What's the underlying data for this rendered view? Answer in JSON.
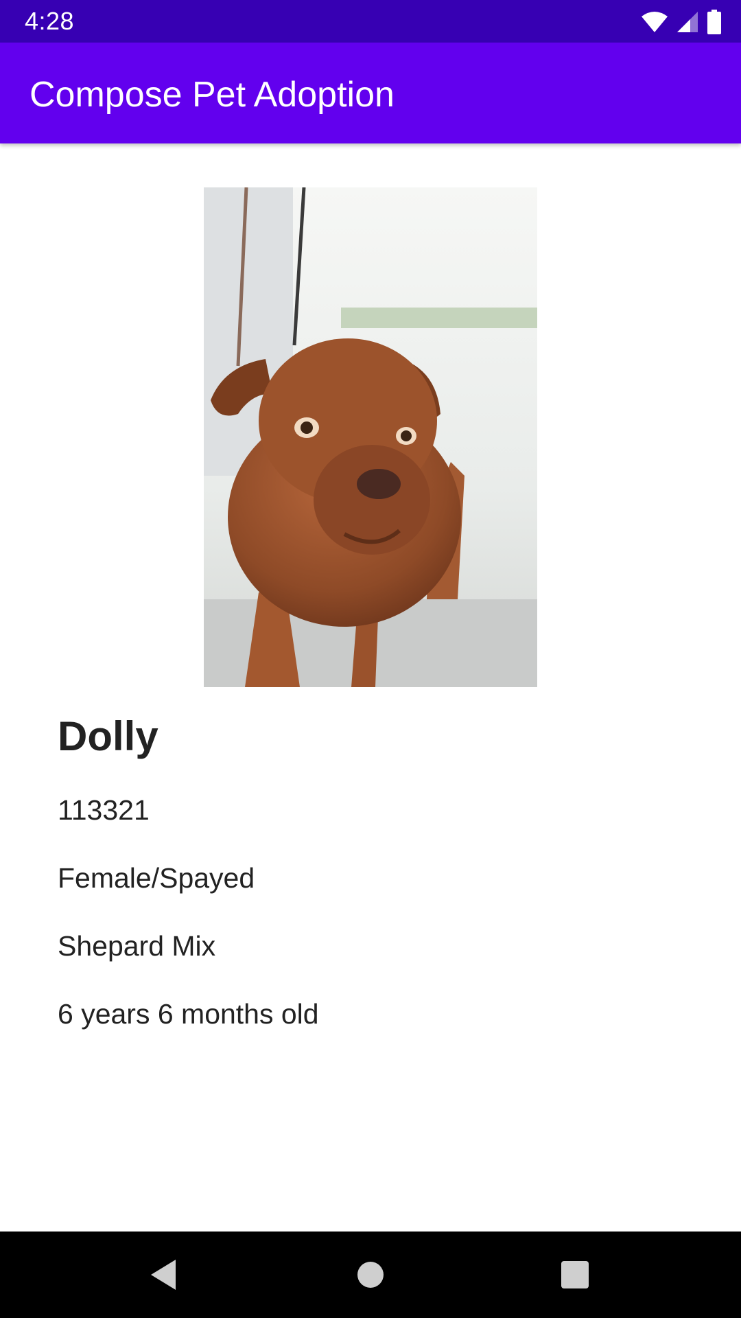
{
  "status_bar": {
    "time": "4:28",
    "icons": [
      "wifi-icon",
      "cellular-signal-icon",
      "battery-icon"
    ]
  },
  "app_bar": {
    "title": "Compose Pet Adoption"
  },
  "pet": {
    "photo": "dog-photo",
    "name": "Dolly",
    "id": "113321",
    "sex": "Female/Spayed",
    "breed": "Shepard Mix",
    "age": "6 years 6 months old"
  },
  "nav_bar": {
    "icons": [
      "back-icon",
      "home-icon",
      "recents-icon"
    ]
  },
  "colors": {
    "status_bar": "#3700B3",
    "app_bar": "#6200EE",
    "nav_bar": "#000000",
    "text": "#222222"
  }
}
